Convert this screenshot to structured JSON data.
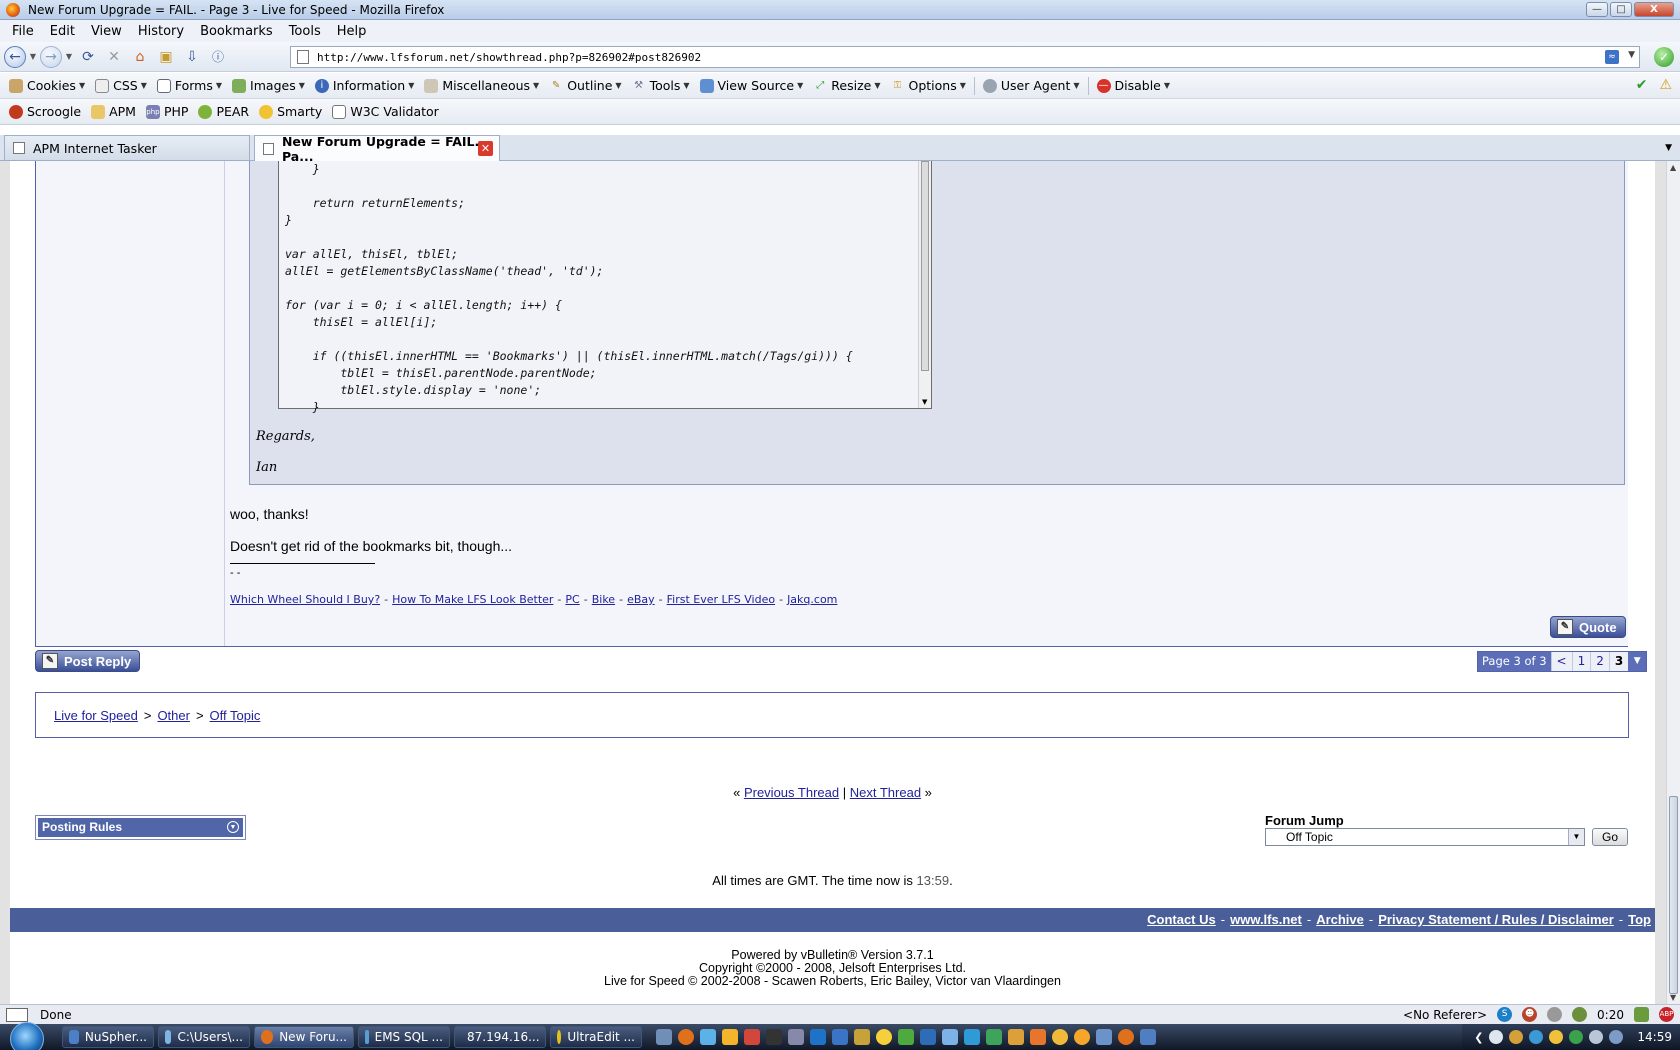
{
  "window": {
    "title": "New Forum Upgrade = FAIL. - Page 3 - Live for Speed - Mozilla Firefox",
    "controls": {
      "minimize": "—",
      "maximize": "□",
      "close": "X"
    }
  },
  "menu": [
    "File",
    "Edit",
    "View",
    "History",
    "Bookmarks",
    "Tools",
    "Help"
  ],
  "address": {
    "url": "http://www.lfsforum.net/showthread.php?p=826902#post826902"
  },
  "devtoolbar": {
    "items": [
      "Cookies",
      "CSS",
      "Forms",
      "Images",
      "Information",
      "Miscellaneous",
      "Outline",
      "Tools",
      "View Source",
      "Resize",
      "Options",
      "User Agent",
      "Disable"
    ]
  },
  "bookmarks": [
    "Scroogle",
    "APM",
    "PHP",
    "PEAR",
    "Smarty",
    "W3C Validator"
  ],
  "tabs": [
    {
      "label": "APM Internet Tasker"
    },
    {
      "label": "New Forum Upgrade = FAIL. - Pa..."
    }
  ],
  "post": {
    "code_lines": [
      "    }",
      "",
      "    return returnElements;",
      "}",
      "",
      "var allEl, thisEl, tblEl;",
      "allEl = getElementsByClassName('thead', 'td');",
      "",
      "for (var i = 0; i < allEl.length; i++) {",
      "    thisEl = allEl[i];",
      "",
      "    if ((thisEl.innerHTML == 'Bookmarks') || (thisEl.innerHTML.match(/Tags/gi))) {",
      "        tblEl = thisEl.parentNode.parentNode;",
      "        tblEl.style.display = 'none';",
      "    }"
    ],
    "quote_regards": "Regards,",
    "quote_name": "Ian",
    "text1": "woo, thanks!",
    "text2": "Doesn't get rid of the bookmarks bit, though...",
    "sig_dashes": "- -",
    "sig_links": [
      "Which Wheel Should I Buy?",
      "How To Make LFS Look Better",
      "PC",
      "Bike",
      "eBay",
      "First Ever LFS Video",
      "Jakq.com"
    ],
    "quote_button": "Quote"
  },
  "post_reply": "Post Reply",
  "pager": {
    "label": "Page 3 of 3",
    "prev": "<",
    "pages": [
      "1",
      "2",
      "3"
    ],
    "current": "3"
  },
  "breadcrumb": [
    "Live for Speed",
    "Other",
    "Off Topic"
  ],
  "thread_nav": {
    "prev": "Previous Thread",
    "next": "Next Thread",
    "left": "«",
    "sep": "|",
    "right": "»"
  },
  "posting_rules": "Posting Rules",
  "forum_jump": {
    "label": "Forum Jump",
    "selected": "Off Topic",
    "go": "Go"
  },
  "timeinfo": {
    "prefix": "All times are GMT. The time now is ",
    "time": "13:59",
    "suffix": "."
  },
  "footer_links": [
    "Contact Us",
    "www.lfs.net",
    "Archive",
    "Privacy Statement / Rules / Disclaimer",
    "Top"
  ],
  "copyright": [
    "Powered by vBulletin® Version 3.7.1",
    "Copyright ©2000 - 2008, Jelsoft Enterprises Ltd.",
    "Live for Speed © 2002-2008 - Scawen Roberts, Eric Bailey, Victor van Vlaardingen"
  ],
  "status": {
    "text": "Done",
    "referer": "<No Referer>",
    "timer": "0:20"
  },
  "taskbar": {
    "tasks": [
      "NuSpher...",
      "C:\\Users\\...",
      "New Foru...",
      "EMS SQL ...",
      "87.194.16...",
      "UltraEdit ..."
    ],
    "clock": "14:59"
  },
  "colors": {
    "accent": "#4a5f9a",
    "link": "#22229c",
    "panel": "#f3f5fa",
    "quote_bg": "#dde1ee"
  }
}
